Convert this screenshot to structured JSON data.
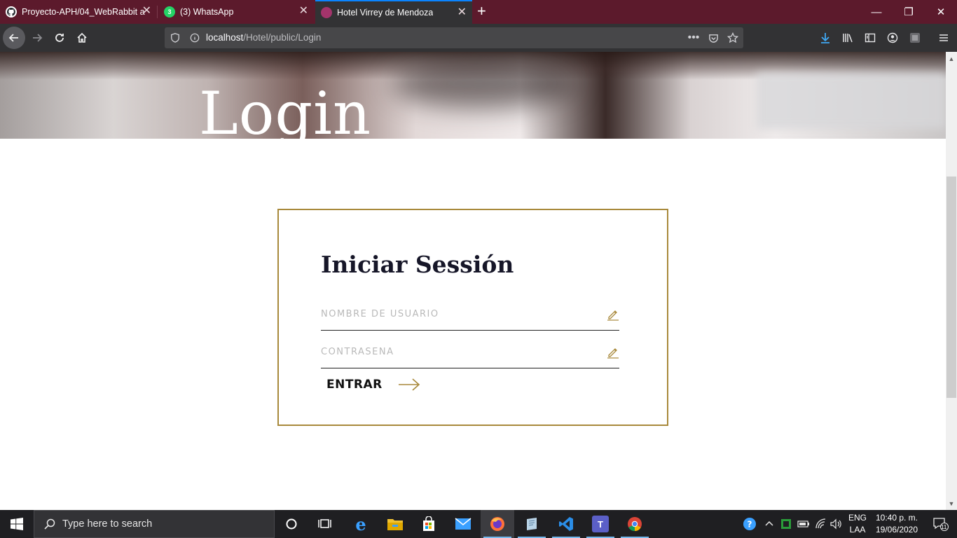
{
  "browser": {
    "tabs": [
      {
        "title": "Proyecto-APH/04_WebRabbit a",
        "icon": "github-icon"
      },
      {
        "title": "(3) WhatsApp",
        "icon": "whatsapp-icon",
        "badge": "3"
      },
      {
        "title": "Hotel Virrey de Mendoza",
        "icon": "site-icon",
        "active": true
      }
    ],
    "url_host": "localhost",
    "url_path": "/Hotel/public/Login"
  },
  "page": {
    "hero_title": "Login",
    "login": {
      "heading": "Iniciar Sessión",
      "username_placeholder": "NOMBRE DE USUARIO",
      "password_placeholder": "CONTRASEÑA",
      "submit_label": "ENTRAR"
    }
  },
  "taskbar": {
    "search_placeholder": "Type here to search",
    "lang_top": "ENG",
    "lang_bottom": "LAA",
    "time": "10:40 p. m.",
    "date": "19/06/2020",
    "notification_count": "11"
  },
  "colors": {
    "accent_gold": "#a8893b",
    "tabstrip": "#5c1a2c",
    "browser_chrome": "#323234"
  }
}
